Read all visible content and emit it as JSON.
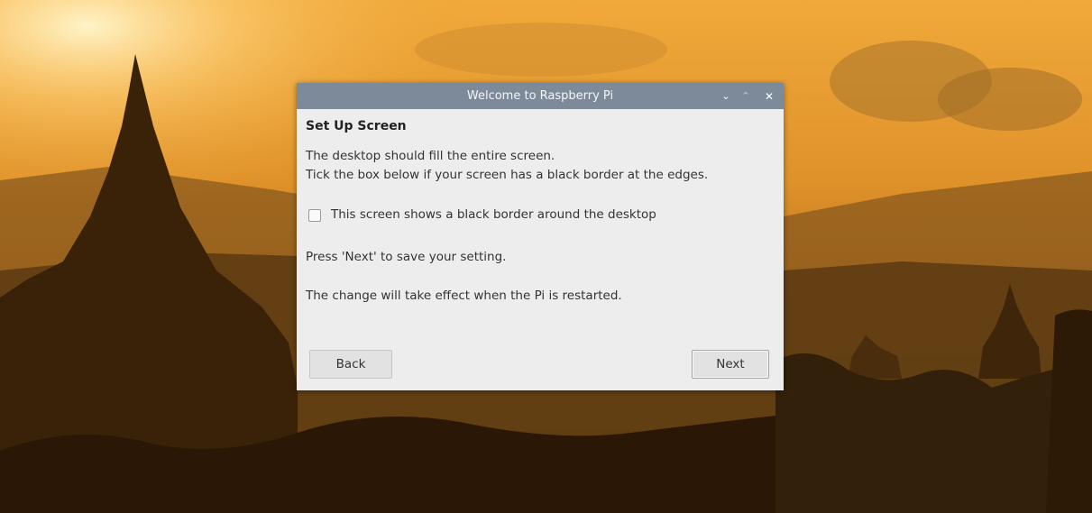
{
  "window": {
    "title": "Welcome to Raspberry Pi",
    "controls": {
      "minimize_icon": "chevron-down-icon",
      "maximize_icon": "chevron-up-icon",
      "close_icon": "close-icon"
    }
  },
  "page": {
    "heading": "Set Up Screen",
    "description_line1": "The desktop should fill the entire screen.",
    "description_line2": "Tick the box below if your screen has a black border at the edges.",
    "checkbox": {
      "label": "This screen shows a black border around the desktop",
      "checked": false
    },
    "note1": "Press 'Next' to save your setting.",
    "note2": "The change will take effect when the Pi is restarted."
  },
  "buttons": {
    "back": "Back",
    "next": "Next"
  },
  "colors": {
    "titlebar": "#7d8a99",
    "window_bg": "#ededed"
  }
}
